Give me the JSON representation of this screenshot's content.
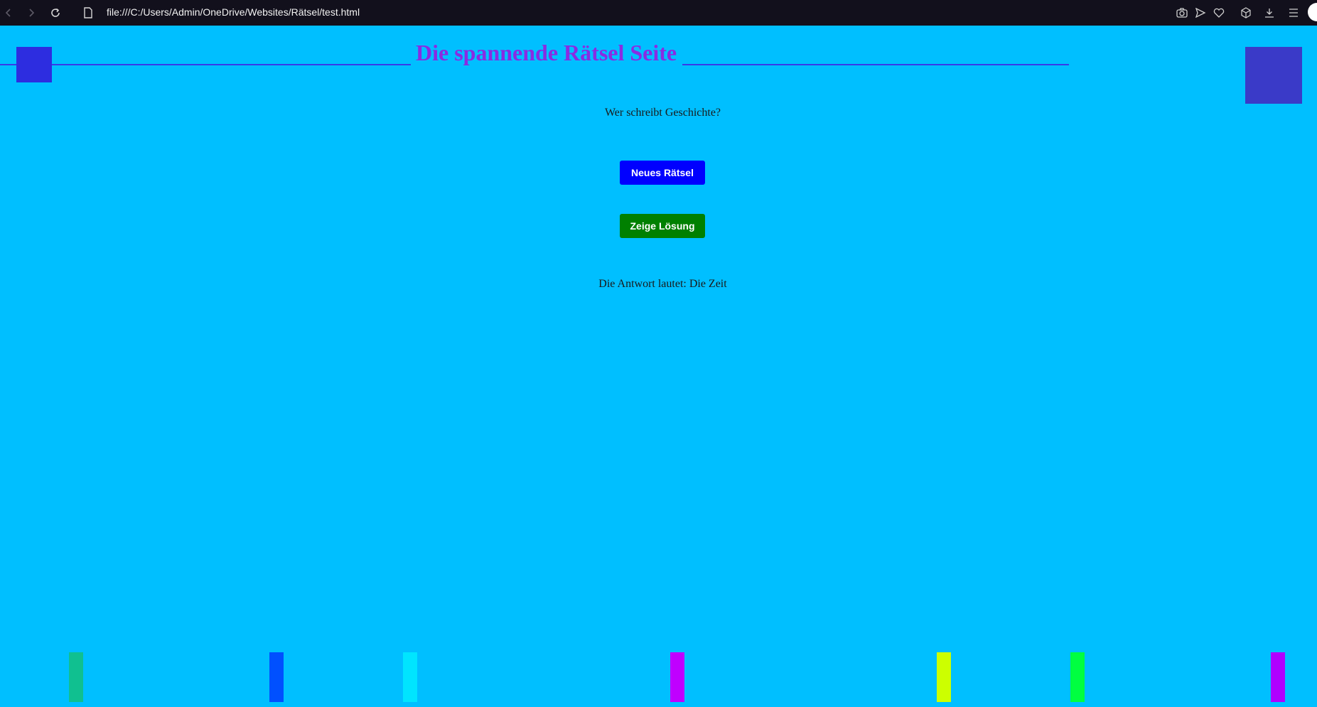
{
  "browser": {
    "url": "file:///C:/Users/Admin/OneDrive/Websites/Rätsel/test.html",
    "icons": [
      "back-icon",
      "forward-icon",
      "reload-icon",
      "file-icon",
      "camera-icon",
      "send-icon",
      "heart-icon",
      "cube-icon",
      "download-icon",
      "menu-icon"
    ]
  },
  "page": {
    "title": "Die spannende Rätsel Seite",
    "riddle": "Wer schreibt Geschichte?",
    "new_riddle_label": "Neues Rätsel",
    "show_solution_label": "Zeige Lösung",
    "answer": "Die Antwort lautet: Die Zeit"
  },
  "colors": {
    "background": "#00bfff",
    "title": "#8a2be2",
    "header_line": "#3a3ae8",
    "square_left": "#2d2de0",
    "square_right": "#3a3ac8",
    "new_button": "#0000ff",
    "solution_button": "#008000",
    "bars": [
      "#10c090",
      "#0050ff",
      "#00e5ff",
      "#c000ff",
      "#ccff00",
      "#00ff40",
      "#b000ff"
    ]
  }
}
